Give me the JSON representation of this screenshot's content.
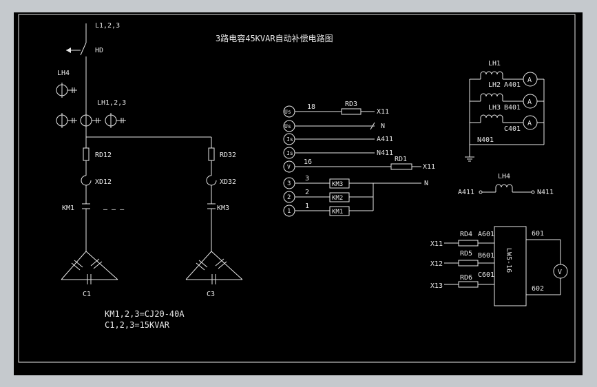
{
  "title": "3路电容45KVAR自动补偿电路图",
  "main": {
    "source": "L1,2,3",
    "switch": "HD",
    "ct_single": "LH4",
    "ct_group": "LH1,2,3",
    "fuses": [
      "RD12",
      "RD32"
    ],
    "lamps": [
      "XD12",
      "XD32"
    ],
    "contactors": [
      "KM1",
      "KM3"
    ],
    "gap": "— — —",
    "capacitors": [
      "C1",
      "C3"
    ],
    "note1": "KM1,2,3=CJ20-40A",
    "note2": "C1,2,3=15KVAR"
  },
  "terminals": {
    "items": [
      {
        "sym": "Us",
        "wire": "18",
        "comp": "RD3",
        "end": "X11"
      },
      {
        "sym": "Us",
        "wire": "",
        "comp": "",
        "end": "N"
      },
      {
        "sym": "Is",
        "wire": "",
        "comp": "",
        "end": "A411"
      },
      {
        "sym": "Is",
        "wire": "",
        "comp": "",
        "end": "N411"
      },
      {
        "sym": "V",
        "wire": "16",
        "comp": "RD1",
        "end": "X11"
      },
      {
        "sym": "3",
        "wire": "3",
        "comp": "KM3",
        "end": "N"
      },
      {
        "sym": "2",
        "wire": "2",
        "comp": "KM2",
        "end": ""
      },
      {
        "sym": "1",
        "wire": "1",
        "comp": "KM1",
        "end": ""
      }
    ]
  },
  "ammeter": {
    "cts": [
      "LH1",
      "LH2",
      "LH3"
    ],
    "wires": [
      "A401",
      "B401",
      "C401"
    ],
    "neutral": "N401",
    "meter": "A"
  },
  "lh4_circuit": {
    "left": "A411",
    "label": "LH4",
    "right": "N411"
  },
  "voltmeter": {
    "inputs": [
      "X11",
      "X12",
      "X13"
    ],
    "fuses": [
      "RD4",
      "RD5",
      "RD6"
    ],
    "wires": [
      "A601",
      "B601",
      "C601"
    ],
    "switch": "LW5-16",
    "out_top": "601",
    "out_bottom": "602",
    "meter": "V"
  }
}
